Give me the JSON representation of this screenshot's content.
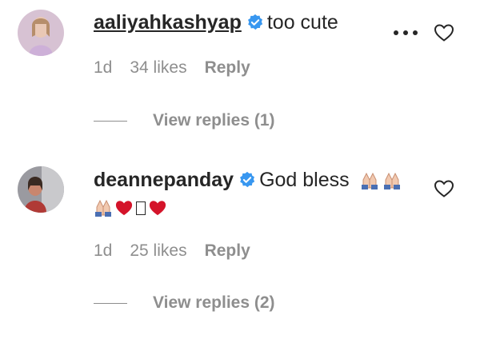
{
  "comments": [
    {
      "username": "aaliyahkashyap",
      "text": "too cute",
      "time": "1d",
      "likes": "34 likes",
      "reply_label": "Reply",
      "view_replies": "View replies (1)"
    },
    {
      "username": "deannepanday",
      "text": "God bless",
      "time": "1d",
      "likes": "25 likes",
      "reply_label": "Reply",
      "view_replies": "View replies (2)"
    }
  ],
  "colors": {
    "verified": "#3897f0",
    "heart_red": "#d4142a",
    "muted": "#8e8e8e"
  },
  "icons": [
    "verified-badge-icon",
    "more-options-icon",
    "heart-icon",
    "folded-hands-emoji",
    "red-heart-emoji"
  ]
}
